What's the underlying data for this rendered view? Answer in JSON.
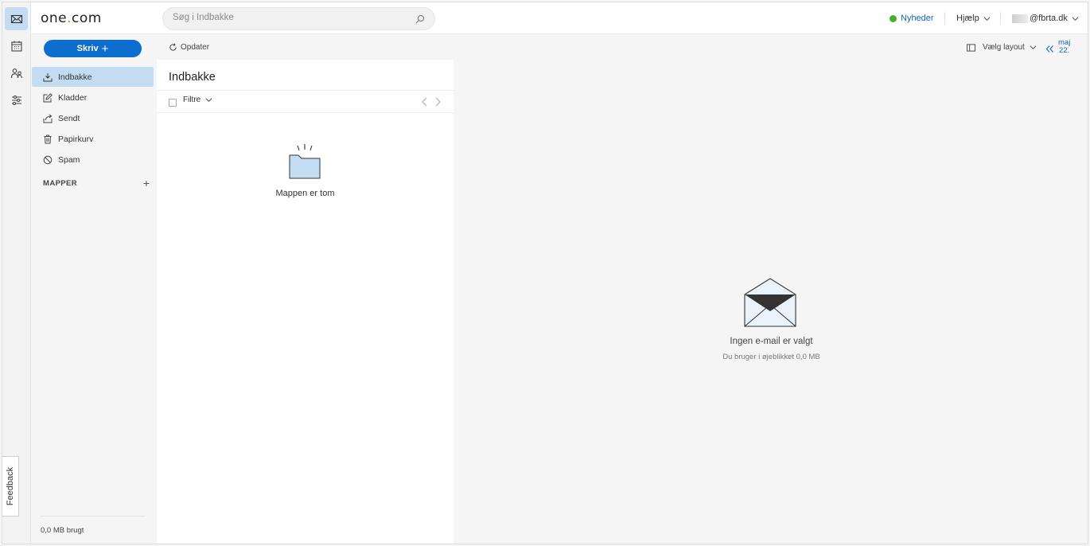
{
  "brand": {
    "logo_pre": "one",
    "logo_dot": ".",
    "logo_post": "com"
  },
  "search": {
    "placeholder": "Søg i Indbakke"
  },
  "header": {
    "news_label": "Nyheder",
    "help_label": "Hjælp",
    "account_label": "@fbrta.dk"
  },
  "rail": {
    "items": [
      "mail-icon",
      "calendar-icon",
      "contacts-icon",
      "settings-sliders-icon"
    ],
    "active": "mail-icon"
  },
  "sidebar": {
    "compose_label": "Skriv",
    "compose_plus": "+",
    "items": [
      {
        "label": "Indbakke",
        "icon": "inbox-icon",
        "active": true
      },
      {
        "label": "Kladder",
        "icon": "drafts-icon",
        "active": false
      },
      {
        "label": "Sendt",
        "icon": "sent-icon",
        "active": false
      },
      {
        "label": "Papirkurv",
        "icon": "trash-icon",
        "active": false
      },
      {
        "label": "Spam",
        "icon": "spam-icon",
        "active": false
      }
    ],
    "folders_header": "MAPPER",
    "folders_add": "+",
    "storage": "0,0 MB brugt"
  },
  "toolbar": {
    "refresh_label": "Opdater",
    "layout_label": "Vælg layout",
    "date_month": "maj",
    "date_day": "22."
  },
  "list": {
    "title": "Indbakke",
    "filter_label": "Filtre",
    "empty_text": "Mappen er tom"
  },
  "reading_pane": {
    "title": "Ingen e-mail er valgt",
    "subtitle": "Du bruger i øjeblikket 0,0 MB"
  },
  "feedback": {
    "label": "Feedback"
  },
  "colors": {
    "accent": "#0d6ecf",
    "active_bg": "#c4dcf1",
    "news_dot": "#43b02a",
    "link": "#1565c0"
  }
}
